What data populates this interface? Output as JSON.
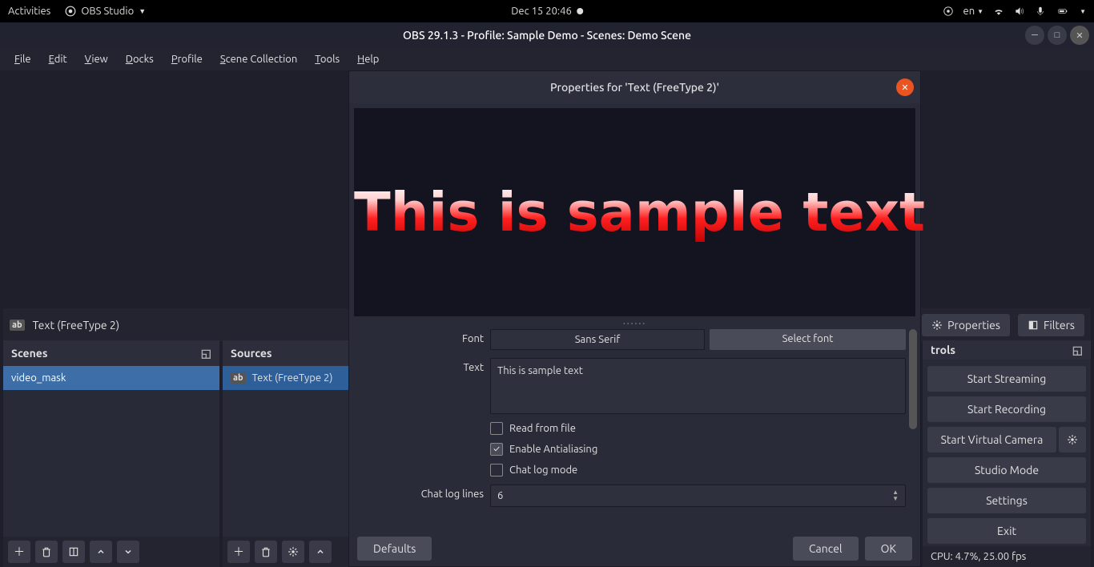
{
  "topbar": {
    "activities": "Activities",
    "app": "OBS Studio",
    "datetime": "Dec 15  20:46",
    "lang": "en"
  },
  "window": {
    "title": "OBS 29.1.3 - Profile: Sample Demo - Scenes: Demo Scene"
  },
  "menubar": [
    "File",
    "Edit",
    "View",
    "Docks",
    "Profile",
    "Scene Collection",
    "Tools",
    "Help"
  ],
  "srcbar": {
    "source_name": "Text (FreeType 2)",
    "properties_btn": "Properties",
    "filters_btn": "Filters"
  },
  "scenes": {
    "title": "Scenes",
    "items": [
      "video_mask"
    ]
  },
  "sources": {
    "title": "Sources",
    "items": [
      "Text (FreeType 2)"
    ]
  },
  "controls": {
    "title": "trols",
    "start_streaming": "Start Streaming",
    "start_recording": "Start Recording",
    "virtual_camera": "Start Virtual Camera",
    "studio_mode": "Studio Mode",
    "settings": "Settings",
    "exit": "Exit",
    "status": "CPU: 4.7%, 25.00 fps"
  },
  "dialog": {
    "title": "Properties for 'Text (FreeType 2)'",
    "preview_text": "This is sample text",
    "font_label": "Font",
    "font_value": "Sans Serif",
    "select_font": "Select font",
    "text_label": "Text",
    "text_value": "This is sample text",
    "read_from_file": "Read from file",
    "antialiasing": "Enable Antialiasing",
    "chat_log_mode": "Chat log mode",
    "chat_log_lines_label": "Chat log lines",
    "chat_log_lines_value": "6",
    "defaults": "Defaults",
    "cancel": "Cancel",
    "ok": "OK"
  }
}
